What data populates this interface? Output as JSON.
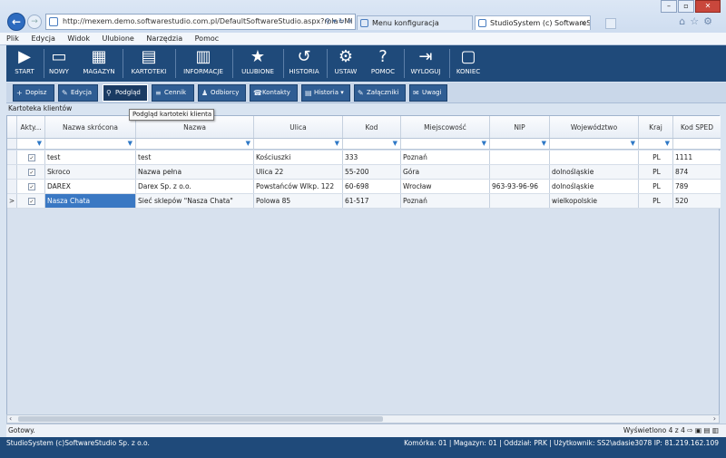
{
  "browser": {
    "url": "http://mexem.demo.softwarestudio.com.pl/DefaultSoftwareStudio.aspx?rola=MI",
    "tabs": [
      {
        "label": "Menu konfiguracja",
        "active": false
      },
      {
        "label": "StudioSystem (c) SoftwareS...",
        "active": true
      }
    ],
    "menu": [
      "Plik",
      "Edycja",
      "Widok",
      "Ulubione",
      "Narzędzia",
      "Pomoc"
    ]
  },
  "toolbar": [
    {
      "label": "START",
      "icon": "play-icon",
      "glyph": "▶"
    },
    {
      "label": "NOWY",
      "icon": "new-document-icon",
      "glyph": "▭"
    },
    {
      "label": "MAGAZYN",
      "icon": "warehouse-icon",
      "glyph": "▦"
    },
    {
      "label": "KARTOTEKI",
      "icon": "cards-icon",
      "glyph": "▤"
    },
    {
      "label": "INFORMACJE",
      "icon": "chart-icon",
      "glyph": "▥"
    },
    {
      "label": "ULUBIONE",
      "icon": "star-icon",
      "glyph": "★"
    },
    {
      "label": "HISTORIA",
      "icon": "history-icon",
      "glyph": "↺"
    },
    {
      "label": "USTAW",
      "icon": "gears-icon",
      "glyph": "⚙"
    },
    {
      "label": "POMOC",
      "icon": "help-icon",
      "glyph": "?"
    },
    {
      "label": "WYLOGUJ",
      "icon": "logout-icon",
      "glyph": "⇥"
    },
    {
      "label": "KONIEC",
      "icon": "exit-icon",
      "glyph": "▢"
    }
  ],
  "actions": [
    {
      "label": "Dopisz",
      "icon": "add-icon",
      "glyph": "+"
    },
    {
      "label": "Edycja",
      "icon": "edit-icon",
      "glyph": "✎"
    },
    {
      "label": "Podgląd",
      "icon": "preview-icon",
      "glyph": "⚲"
    },
    {
      "label": "Cennik",
      "icon": "price-list-icon",
      "glyph": "≡"
    },
    {
      "label": "Odbiorcy",
      "icon": "recipients-icon",
      "glyph": "♟"
    },
    {
      "label": "Kontakty",
      "icon": "contacts-icon",
      "glyph": "☎"
    },
    {
      "label": "Historia ▾",
      "icon": "history-icon",
      "glyph": "▤"
    },
    {
      "label": "Załączniki",
      "icon": "attachment-icon",
      "glyph": "✎"
    },
    {
      "label": "Uwagi",
      "icon": "notes-icon",
      "glyph": "✉"
    }
  ],
  "tooltip": "Podgląd kartoteki klienta",
  "section_title": "Kartoteka klientów",
  "grid": {
    "columns": [
      "Akty...",
      "Nazwa skrócona",
      "Nazwa",
      "Ulica",
      "Kod",
      "Miejscowość",
      "NIP",
      "Województwo",
      "Kraj",
      "Kod SPED"
    ],
    "rows": [
      {
        "active": "✓",
        "short": "test",
        "name": "test",
        "street": "Kościuszki",
        "code": "333",
        "city": "Poznań",
        "nip": "",
        "province": "",
        "country": "PL",
        "sped": "1111"
      },
      {
        "active": "✓",
        "short": "Skroco",
        "name": "Nazwa pełna",
        "street": "Ulica 22",
        "code": "55-200",
        "city": "Góra",
        "nip": "",
        "province": "dolnośląskie",
        "country": "PL",
        "sped": "874"
      },
      {
        "active": "✓",
        "short": "DAREX",
        "name": "Darex Sp. z o.o.",
        "street": "Powstańców Wlkp. 122",
        "code": "60-698",
        "city": "Wrocław",
        "nip": "963-93-96-96",
        "province": "dolnośląskie",
        "country": "PL",
        "sped": "789"
      },
      {
        "active": "✓",
        "short": "Nasza Chata",
        "name": "Sieć sklepów \"Nasza Chata\"",
        "street": "Polowa 85",
        "code": "61-517",
        "city": "Poznań",
        "nip": "",
        "province": "wielkopolskie",
        "country": "PL",
        "sped": "520"
      }
    ],
    "current_row_marker": ">"
  },
  "status": {
    "left": "Gotowy.",
    "right": "Wyświetlono 4 z 4"
  },
  "footer": {
    "company": "StudioSystem (c)SoftwareStudio Sp. z o.o.",
    "info": "Komórka: 01 | Magazyn: 01 | Oddział: PRK | Użytkownik: SS2\\adasie3078 IP: 81.219.162.109"
  },
  "colors": {
    "toolbar_bg": "#1f4a7a",
    "button_bg": "#2f5d93",
    "selection": "#3a78c3"
  }
}
